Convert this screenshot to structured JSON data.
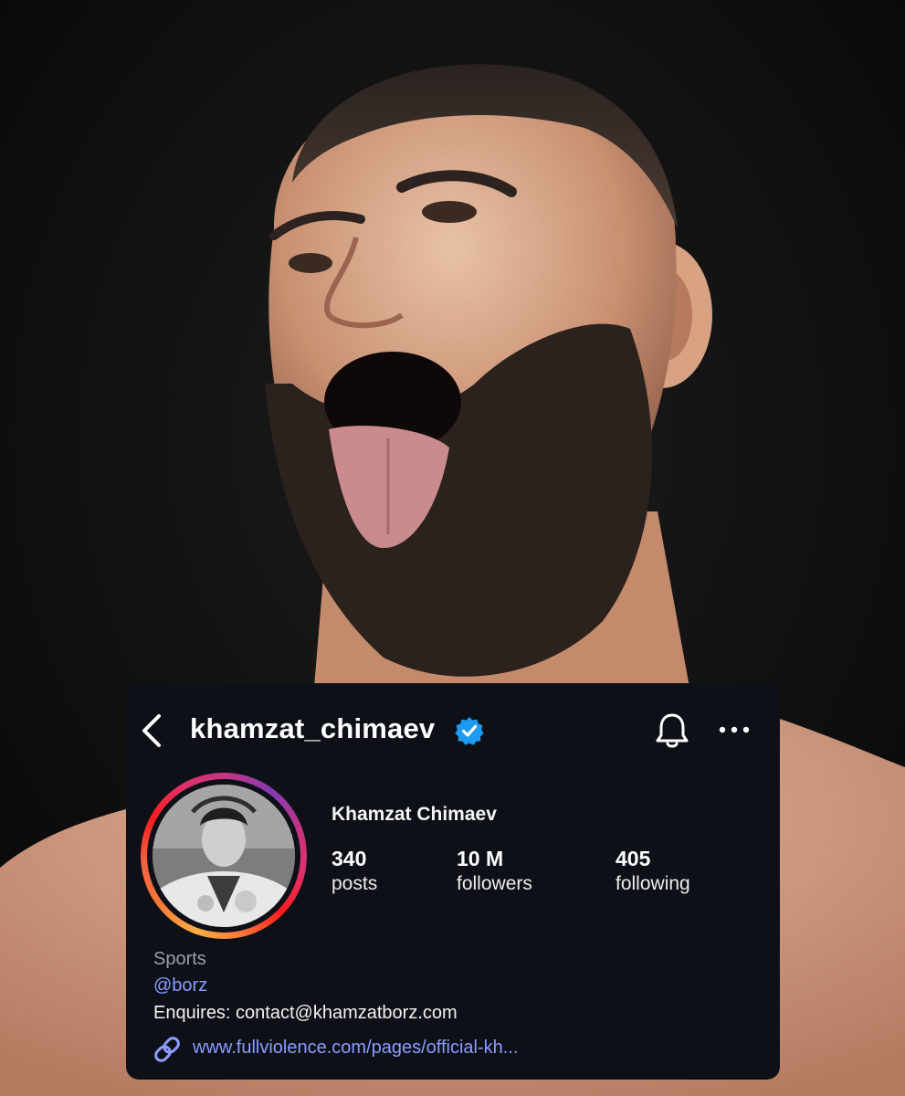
{
  "profile": {
    "username": "khamzat_chimaev",
    "display_name": "Khamzat Chimaev",
    "category": "Sports",
    "handle": "@borz",
    "bio": "Enquires: contact@khamzatborz.com",
    "link": "www.fullviolence.com/pages/official-kh..."
  },
  "stats": {
    "posts": {
      "value": "340",
      "label": "posts"
    },
    "followers": {
      "value": "10 M",
      "label": "followers"
    },
    "following": {
      "value": "405",
      "label": "following"
    }
  },
  "icons": {
    "back": "chevron-left-icon",
    "verified": "verified-badge-icon",
    "bell": "bell-icon",
    "more": "more-horizontal-icon",
    "link": "link-icon"
  },
  "colors": {
    "card_background": "#0d1117",
    "verified_blue": "#1d9bf0",
    "link_color": "#8c9bff",
    "muted_text": "#9aa0a6",
    "story_ring": [
      "#fcaf45",
      "#fd1d1d",
      "#e1306c",
      "#c13584",
      "#833ab4"
    ]
  }
}
